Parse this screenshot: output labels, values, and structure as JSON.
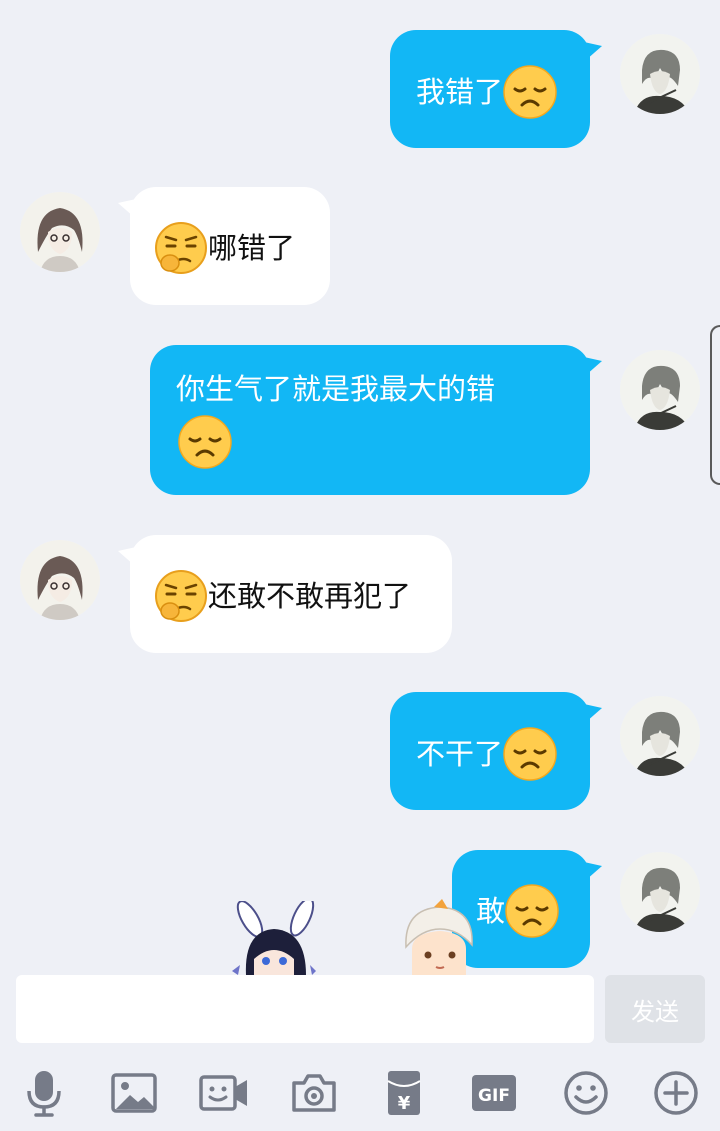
{
  "messages": [
    {
      "side": "out",
      "text": "我错了",
      "emoji": "disappointed-emoji"
    },
    {
      "side": "in",
      "text": "哪错了",
      "emoji": "thinking-emoji"
    },
    {
      "side": "out",
      "text": "你生气了就是我最大的错",
      "emoji": "disappointed-emoji"
    },
    {
      "side": "in",
      "text": "还敢不敢再犯了",
      "emoji": "thinking-emoji"
    },
    {
      "side": "out",
      "text": "不干了",
      "emoji": "disappointed-emoji"
    },
    {
      "side": "out",
      "text": "敢",
      "emoji": "disappointed-emoji"
    }
  ],
  "input": {
    "value": "",
    "placeholder": ""
  },
  "send_label": "发送",
  "toolbar": {
    "icons": [
      "microphone-icon",
      "image-icon",
      "video-call-icon",
      "camera-icon",
      "red-envelope-icon",
      "gif-icon",
      "emoji-face-icon",
      "plus-icon"
    ],
    "gif_label": "GIF"
  },
  "colors": {
    "outgoing_bubble": "#12b7f5",
    "incoming_bubble": "#ffffff",
    "background": "#eef0f6",
    "send_button": "#dfe2e7",
    "icon": "#767b88"
  }
}
